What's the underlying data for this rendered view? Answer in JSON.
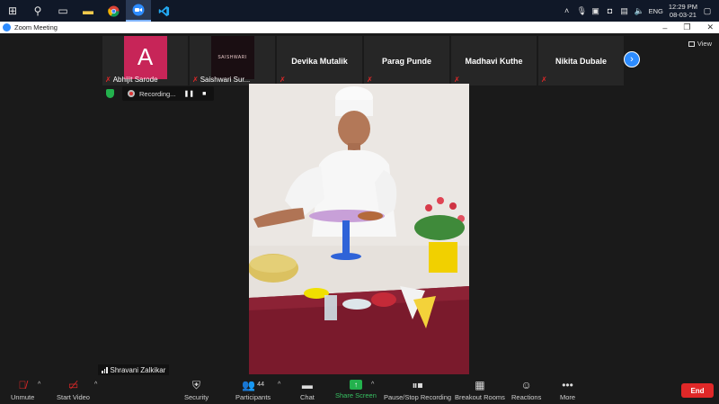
{
  "taskbar": {
    "apps": [
      "windows-start",
      "search",
      "task-view",
      "file-explorer",
      "chrome",
      "zoom",
      "vscode"
    ],
    "time": "12:29 PM",
    "date": "08-03-21",
    "language": "ENG"
  },
  "window": {
    "title": "Zoom Meeting"
  },
  "gallery": {
    "view_label": "View",
    "participants": [
      {
        "name": "Abhijit Sarode",
        "avatar_letter": "A",
        "avatar_color": "#c72558",
        "muted": true
      },
      {
        "name": "Saishwari Sur...",
        "avatar_text": "SAISHWARI",
        "muted": true
      },
      {
        "name": "Devika Mutalik",
        "muted": true
      },
      {
        "name": "Parag Punde",
        "muted": true
      },
      {
        "name": "Madhavi Kuthe",
        "muted": true
      },
      {
        "name": "Nikita Dubale",
        "muted": true
      }
    ]
  },
  "recording": {
    "label": "Recording..."
  },
  "active_speaker": {
    "name": "Shravani Zalkikar"
  },
  "toolbar": {
    "unmute": "Unmute",
    "start_video": "Start Video",
    "security": "Security",
    "participants": "Participants",
    "participants_count": "44",
    "chat": "Chat",
    "share_screen": "Share Screen",
    "pause_recording": "Pause/Stop Recording",
    "breakout_rooms": "Breakout Rooms",
    "reactions": "Reactions",
    "more": "More",
    "end": "End"
  },
  "colors": {
    "accent": "#2d8cff",
    "end": "#e02828",
    "share": "#23b14d",
    "background": "#1a1a1a"
  }
}
